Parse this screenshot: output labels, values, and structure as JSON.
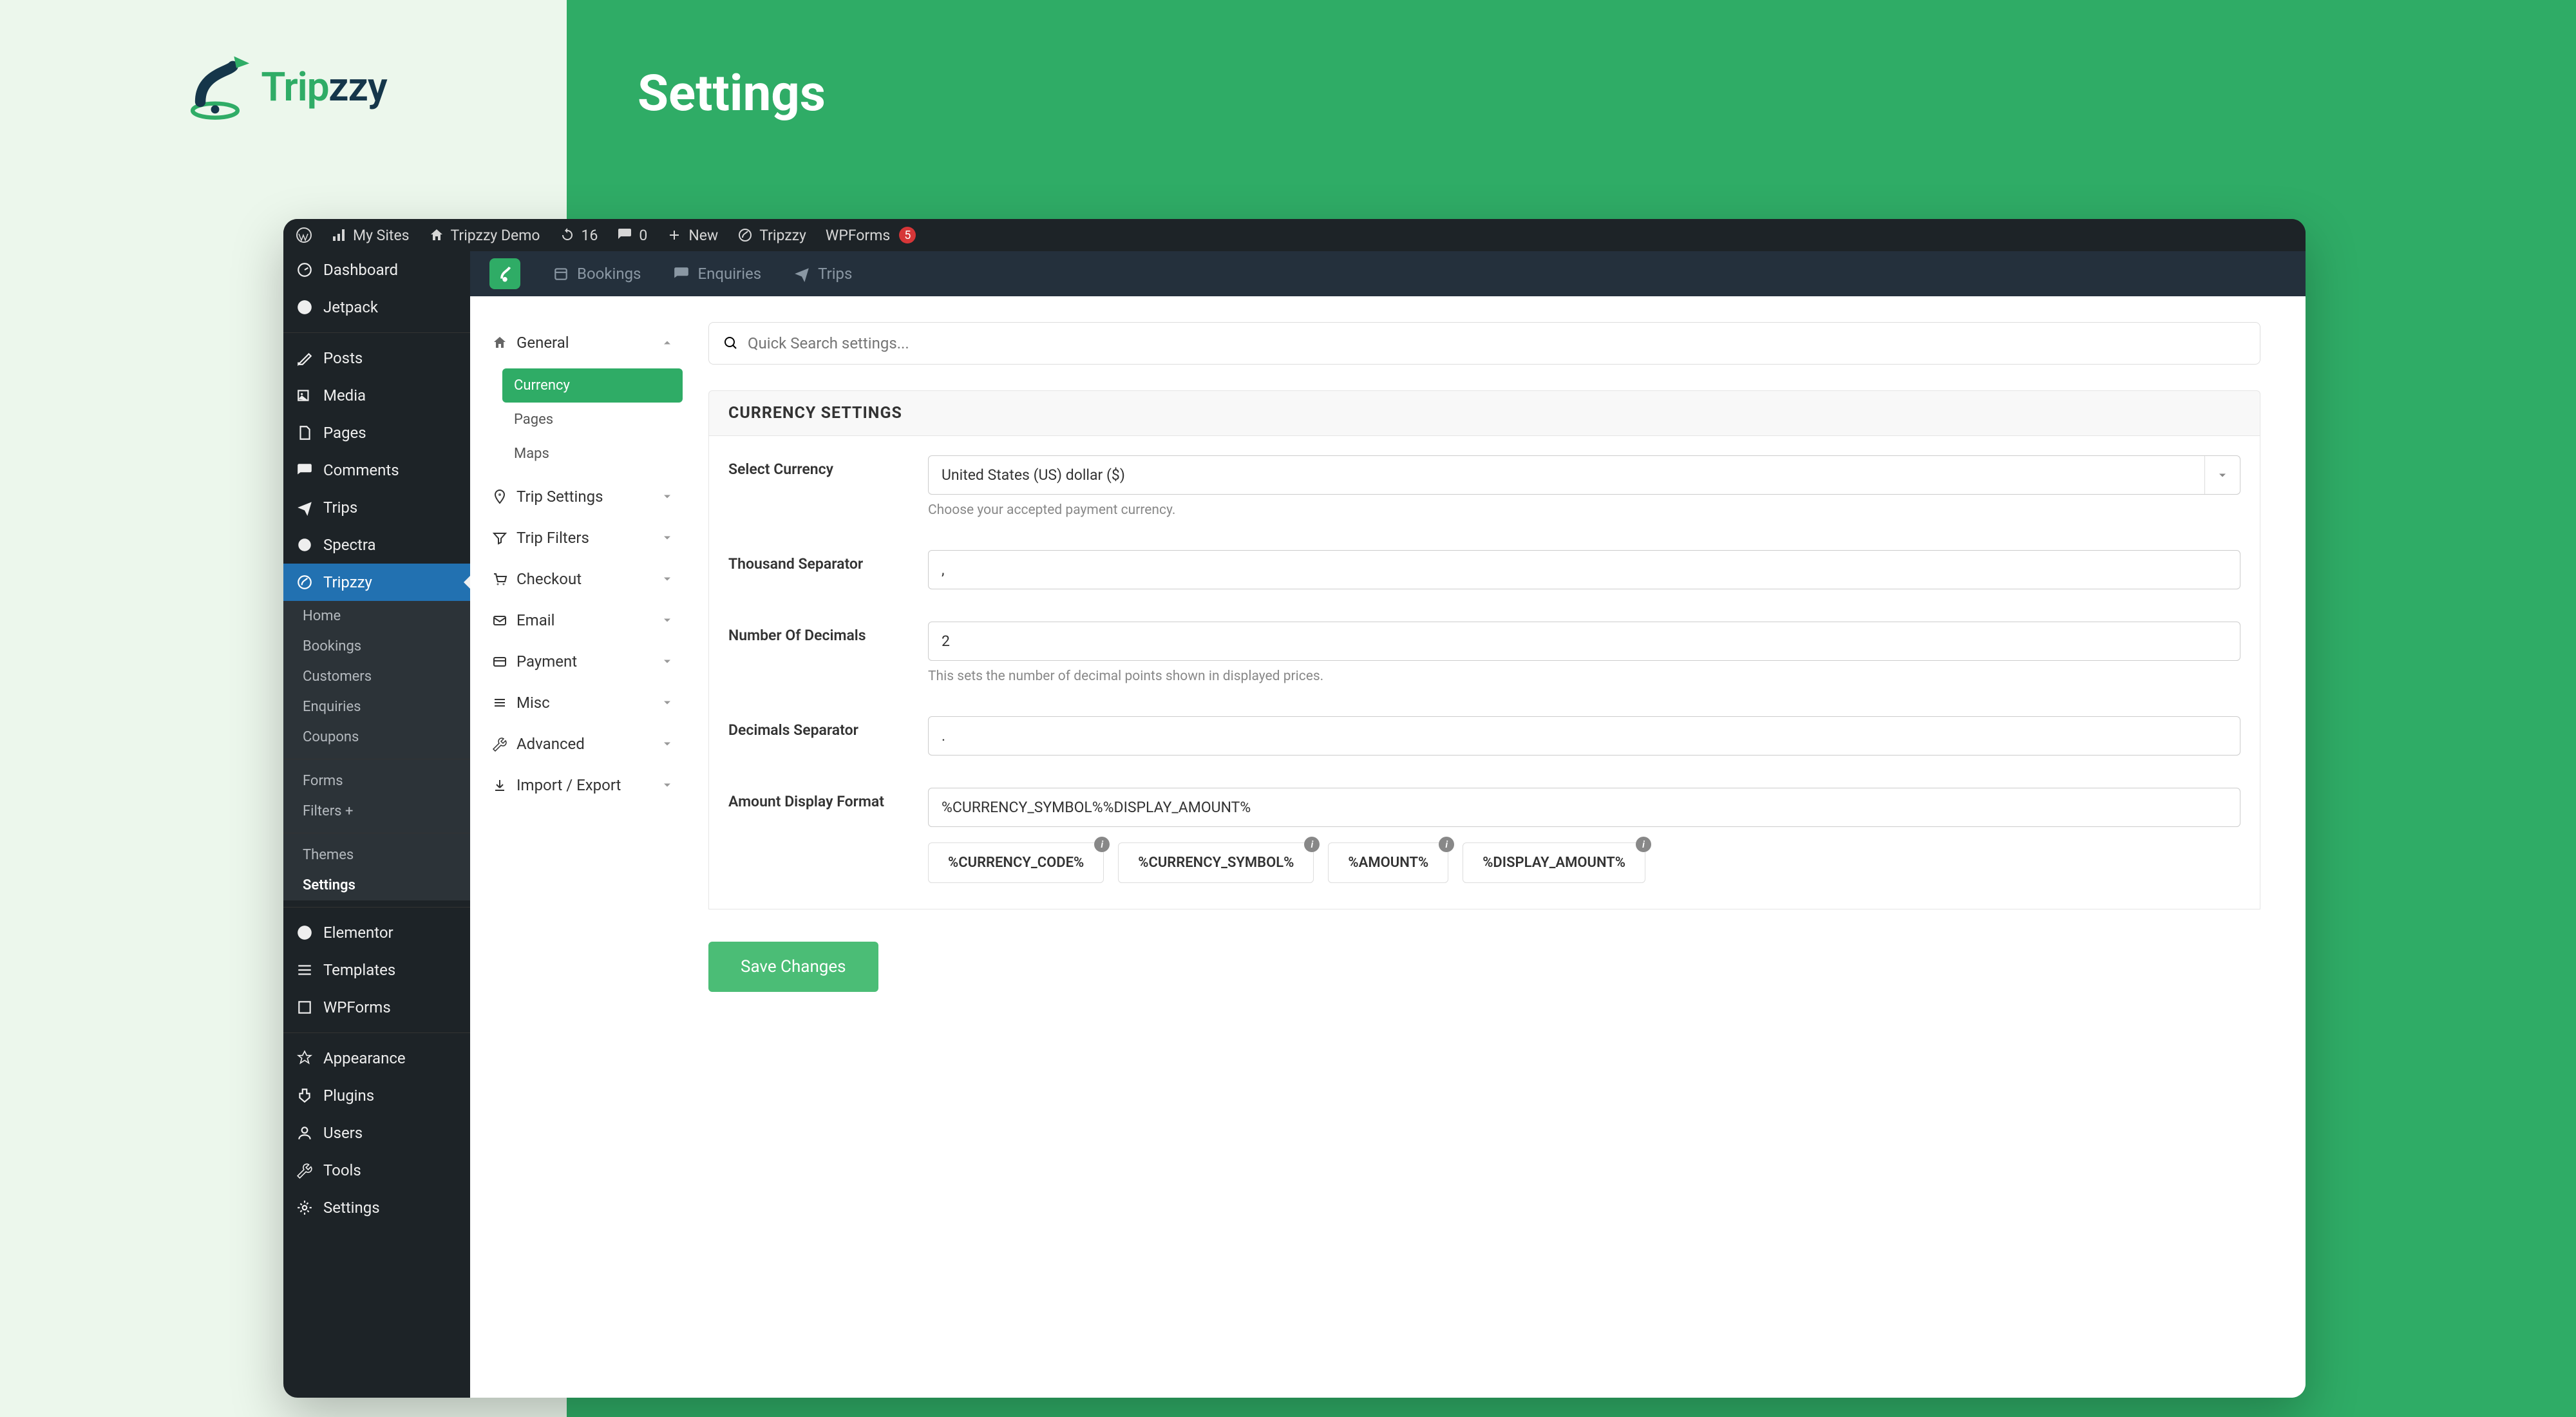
{
  "brand": {
    "name_a": "Trip",
    "name_b": "zzy"
  },
  "band_title": "Settings",
  "admin_bar": {
    "my_sites": "My Sites",
    "site_name": "Tripzzy Demo",
    "updates": "16",
    "comments": "0",
    "new": "New",
    "tripzzy": "Tripzzy",
    "wpforms": "WPForms",
    "wpforms_badge": "5"
  },
  "wp_side": {
    "dashboard": "Dashboard",
    "jetpack": "Jetpack",
    "posts": "Posts",
    "media": "Media",
    "pages": "Pages",
    "comments": "Comments",
    "trips": "Trips",
    "spectra": "Spectra",
    "tripzzy": "Tripzzy",
    "sub": {
      "home": "Home",
      "bookings": "Bookings",
      "customers": "Customers",
      "enquiries": "Enquiries",
      "coupons": "Coupons",
      "forms": "Forms",
      "filters": "Filters +",
      "themes": "Themes",
      "settings": "Settings"
    },
    "elementor": "Elementor",
    "templates": "Templates",
    "wpforms": "WPForms",
    "appearance": "Appearance",
    "plugins": "Plugins",
    "users": "Users",
    "tools": "Tools",
    "settings": "Settings"
  },
  "plugin_bar": {
    "bookings": "Bookings",
    "enquiries": "Enquiries",
    "trips": "Trips"
  },
  "settings_side": {
    "general": "General",
    "sub": {
      "currency": "Currency",
      "pages": "Pages",
      "maps": "Maps"
    },
    "trip_settings": "Trip Settings",
    "trip_filters": "Trip Filters",
    "checkout": "Checkout",
    "email": "Email",
    "payment": "Payment",
    "misc": "Misc",
    "advanced": "Advanced",
    "import_export": "Import / Export"
  },
  "search_placeholder": "Quick Search settings...",
  "section_title": "CURRENCY SETTINGS",
  "fields": {
    "select_currency": {
      "label": "Select Currency",
      "value": "United States (US) dollar ($)",
      "hint": "Choose your accepted payment currency."
    },
    "thousand_sep": {
      "label": "Thousand Separator",
      "value": ","
    },
    "decimals": {
      "label": "Number Of Decimals",
      "value": "2",
      "hint": "This sets the number of decimal points shown in displayed prices."
    },
    "dec_sep": {
      "label": "Decimals Separator",
      "value": "."
    },
    "format": {
      "label": "Amount Display Format",
      "value": "%CURRENCY_SYMBOL%%DISPLAY_AMOUNT%",
      "chips": [
        "%CURRENCY_CODE%",
        "%CURRENCY_SYMBOL%",
        "%AMOUNT%",
        "%DISPLAY_AMOUNT%"
      ]
    }
  },
  "save_label": "Save Changes"
}
